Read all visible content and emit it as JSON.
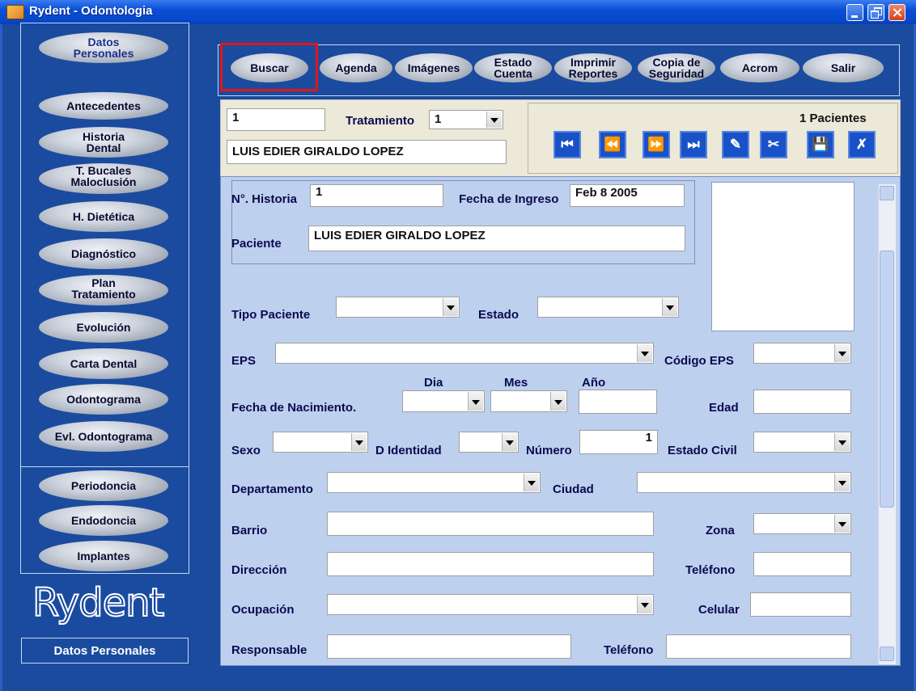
{
  "window": {
    "title": "Rydent - Odontologia"
  },
  "left_nav": {
    "items": [
      {
        "label": "Datos\nPersonales"
      },
      {
        "label": "Antecedentes"
      },
      {
        "label": "Historia\nDental"
      },
      {
        "label": "T. Bucales\nMaloclusión"
      },
      {
        "label": "H. Dietética"
      },
      {
        "label": "Diagnóstico"
      },
      {
        "label": "Plan\nTratamiento"
      },
      {
        "label": "Evolución"
      },
      {
        "label": "Carta Dental"
      },
      {
        "label": "Odontograma"
      },
      {
        "label": "Evl. Odontograma"
      },
      {
        "label": "Periodoncia"
      },
      {
        "label": "Endodoncia"
      },
      {
        "label": "Implantes"
      }
    ],
    "logo": "Rydent",
    "footer": "Datos Personales"
  },
  "toolbar": {
    "buttons": [
      {
        "label": "Buscar"
      },
      {
        "label": "Agenda"
      },
      {
        "label": "Imágenes"
      },
      {
        "label": "Estado\nCuenta"
      },
      {
        "label": "Imprimir\nReportes"
      },
      {
        "label": "Copia de\nSeguridad"
      },
      {
        "label": "Acrom"
      },
      {
        "label": "Salir"
      }
    ]
  },
  "header": {
    "id_value": "1",
    "tratamiento_label": "Tratamiento",
    "tratamiento_value": "1",
    "patient_name": "LUIS EDIER GIRALDO LOPEZ",
    "record_count": "1 Pacientes"
  },
  "nav_buttons": [
    "first-record",
    "previous-record",
    "next-record",
    "last-record",
    "edit-record",
    "delete-record",
    "save-record",
    "cancel-record"
  ],
  "form": {
    "historia_label": "N°. Historia",
    "historia_value": "1",
    "fecha_ingreso_label": "Fecha de Ingreso",
    "fecha_ingreso_value": "Feb 8 2005",
    "paciente_label": "Paciente",
    "paciente_value": "LUIS EDIER GIRALDO LOPEZ",
    "tipo_paciente_label": "Tipo Paciente",
    "estado_label": "Estado",
    "eps_label": "EPS",
    "codigo_eps_label": "Código EPS",
    "dia_label": "Dia",
    "mes_label": "Mes",
    "anio_label": "Año",
    "fecha_nacimiento_label": "Fecha de Nacimiento.",
    "edad_label": "Edad",
    "sexo_label": "Sexo",
    "d_identidad_label": "D Identidad",
    "numero_label": "Número",
    "numero_value": "1",
    "estado_civil_label": "Estado Civil",
    "departamento_label": "Departamento",
    "ciudad_label": "Ciudad",
    "barrio_label": "Barrio",
    "zona_label": "Zona",
    "direccion_label": "Dirección",
    "telefono_label": "Teléfono",
    "ocupacion_label": "Ocupación",
    "celular_label": "Celular",
    "responsable_label": "Responsable",
    "telefono2_label": "Teléfono"
  }
}
